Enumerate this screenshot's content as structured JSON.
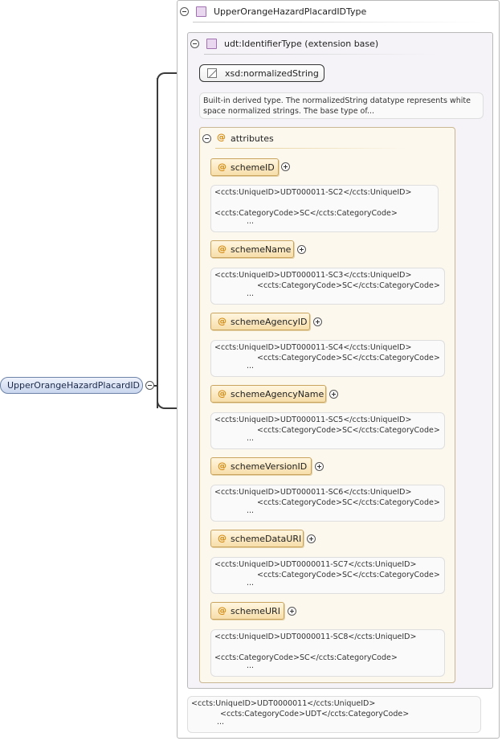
{
  "root_element": {
    "name": "UpperOrangeHazardPlacardID"
  },
  "type": {
    "name": "UpperOrangeHazardPlacardIDType"
  },
  "extension": {
    "name": "udt:IdentifierType (extension base)"
  },
  "base_type": {
    "name": "xsd:normalizedString",
    "doc_line1": "Built-in derived type. The normalizedString datatype represents white",
    "doc_line2": "space normalized strings. The base type of..."
  },
  "attributes_group": {
    "label": "attributes"
  },
  "attributes": [
    {
      "name": "schemeID",
      "doc1": "<ccts:UniqueID>UDT000011-SC2</ccts:UniqueID>",
      "doc2": "",
      "doc3": "<ccts:CategoryCode>SC</ccts:CategoryCode>",
      "more": "..."
    },
    {
      "name": "schemeName",
      "doc1": "<ccts:UniqueID>UDT000011-SC3</ccts:UniqueID>",
      "doc2": "<ccts:CategoryCode>SC</ccts:CategoryCode>",
      "more": "..."
    },
    {
      "name": "schemeAgencyID",
      "doc1": "<ccts:UniqueID>UDT000011-SC4</ccts:UniqueID>",
      "doc2": "<ccts:CategoryCode>SC</ccts:CategoryCode>",
      "more": "..."
    },
    {
      "name": "schemeAgencyName",
      "doc1": "<ccts:UniqueID>UDT000011-SC5</ccts:UniqueID>",
      "doc2": "<ccts:CategoryCode>SC</ccts:CategoryCode>",
      "more": "..."
    },
    {
      "name": "schemeVersionID",
      "doc1": "<ccts:UniqueID>UDT000011-SC6</ccts:UniqueID>",
      "doc2": "<ccts:CategoryCode>SC</ccts:CategoryCode>",
      "more": "..."
    },
    {
      "name": "schemeDataURI",
      "doc1": "<ccts:UniqueID>UDT0000011-SC7</ccts:UniqueID>",
      "doc2": "<ccts:CategoryCode>SC</ccts:CategoryCode>",
      "more": "..."
    },
    {
      "name": "schemeURI",
      "doc1": "<ccts:UniqueID>UDT0000011-SC8</ccts:UniqueID>",
      "doc2": "",
      "doc3": "<ccts:CategoryCode>SC</ccts:CategoryCode>",
      "more": "..."
    }
  ],
  "type_doc": {
    "line1": "<ccts:UniqueID>UDT0000011</ccts:UniqueID>",
    "line2": "<ccts:CategoryCode>UDT</ccts:CategoryCode>",
    "more": "..."
  }
}
